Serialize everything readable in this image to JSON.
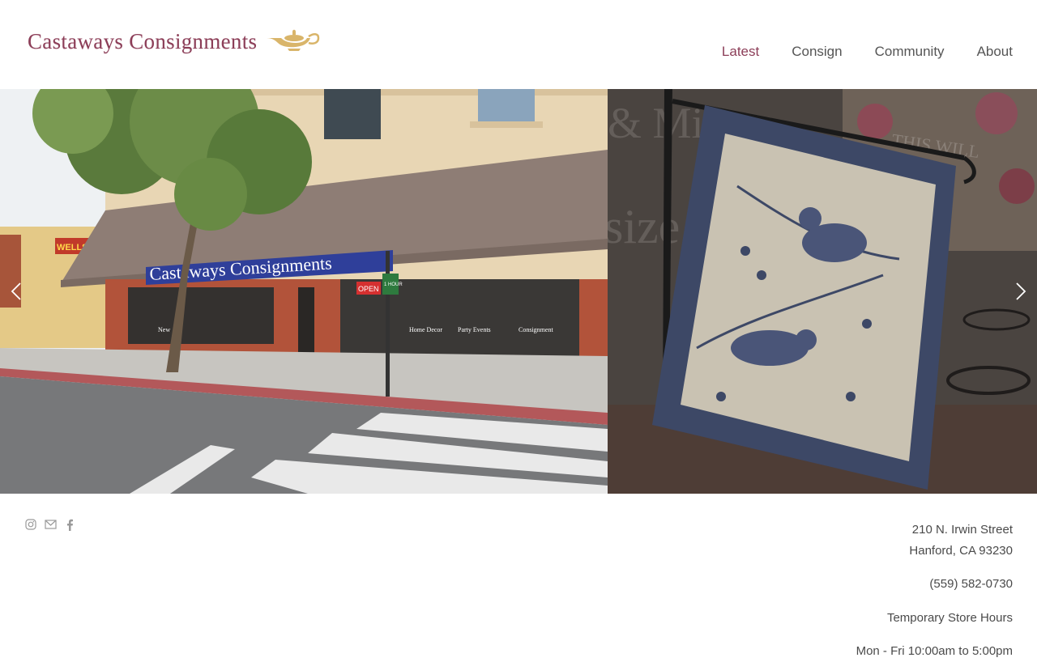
{
  "brand": {
    "name": "Castaways Consignments",
    "color": "#8c3e58",
    "lamp_color": "#d9b56a"
  },
  "nav": {
    "items": [
      {
        "label": "Latest",
        "active": true
      },
      {
        "label": "Consign",
        "active": false
      },
      {
        "label": "Community",
        "active": false
      },
      {
        "label": "About",
        "active": false
      }
    ]
  },
  "slideshow": {
    "left_photo": {
      "sign_text": "Castaways Consignments",
      "bank_sign": "WELLS FA",
      "open_sign": "OPEN",
      "street_sign": "1 HOUR",
      "window_texts": [
        "New",
        "Home Decor",
        "Party Events",
        "Consignment"
      ]
    },
    "right_photo": {
      "window_text": "& Misses",
      "window_text_2": "size",
      "card_text": "THIS WILL"
    },
    "prev_icon": "chevron-left-icon",
    "next_icon": "chevron-right-icon"
  },
  "social": [
    "instagram-icon",
    "mail-icon",
    "facebook-icon"
  ],
  "contact": {
    "address_line1": "210 N. Irwin Street",
    "address_line2": "Hanford, CA 93230",
    "phone": "(559) 582-0730",
    "hours_title": "Temporary Store Hours",
    "hours_line": "Mon - Fri 10:00am to 5:00pm"
  }
}
